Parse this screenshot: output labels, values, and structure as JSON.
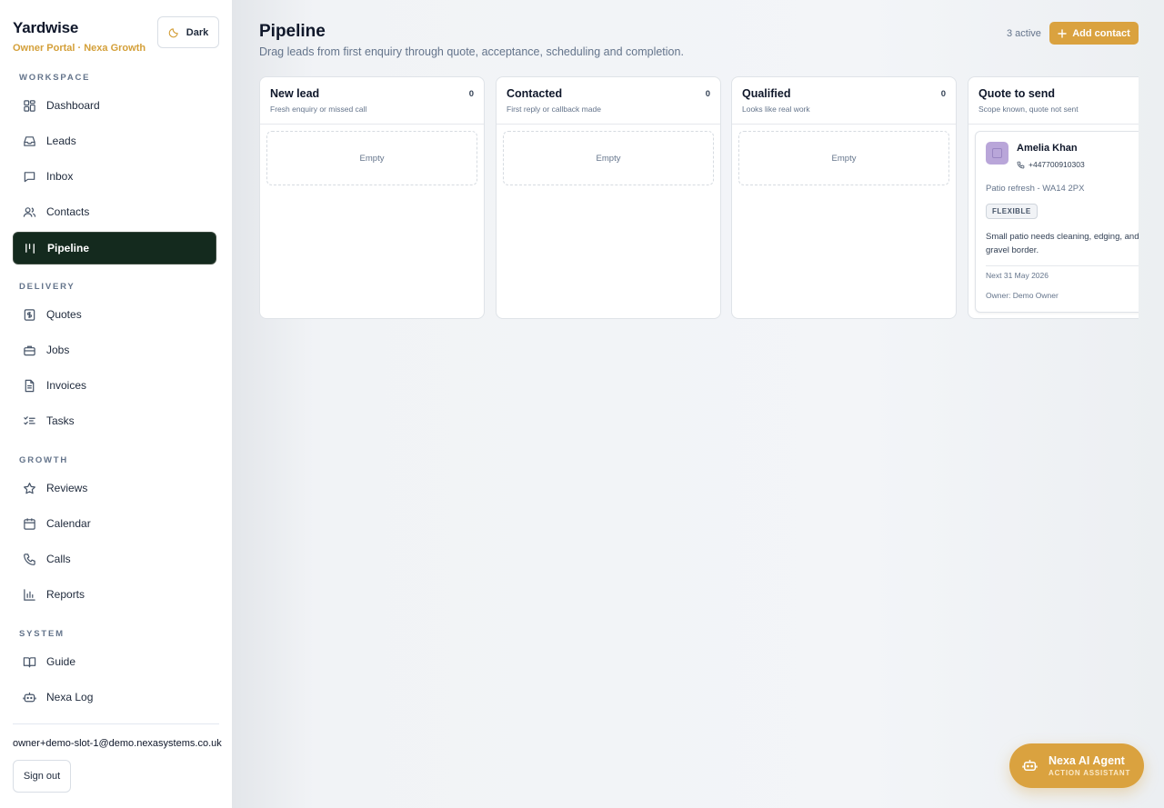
{
  "brand": {
    "name": "Yardwise",
    "subtitle": "Owner Portal · Nexa Growth"
  },
  "theme_toggle": {
    "label": "Dark",
    "icon": "moon-icon"
  },
  "sidebar": {
    "sections": [
      {
        "label": "WORKSPACE",
        "items": [
          {
            "label": "Dashboard",
            "icon": "dashboard-icon"
          },
          {
            "label": "Leads",
            "icon": "inbox-tray-icon"
          },
          {
            "label": "Inbox",
            "icon": "message-icon"
          },
          {
            "label": "Contacts",
            "icon": "users-icon"
          },
          {
            "label": "Pipeline",
            "icon": "kanban-icon",
            "active": true
          }
        ]
      },
      {
        "label": "DELIVERY",
        "items": [
          {
            "label": "Quotes",
            "icon": "dollar-file-icon"
          },
          {
            "label": "Jobs",
            "icon": "briefcase-icon"
          },
          {
            "label": "Invoices",
            "icon": "document-icon"
          },
          {
            "label": "Tasks",
            "icon": "checklist-icon"
          }
        ]
      },
      {
        "label": "GROWTH",
        "items": [
          {
            "label": "Reviews",
            "icon": "star-icon"
          },
          {
            "label": "Calendar",
            "icon": "calendar-icon"
          },
          {
            "label": "Calls",
            "icon": "phone-icon"
          },
          {
            "label": "Reports",
            "icon": "bar-chart-icon"
          }
        ]
      },
      {
        "label": "SYSTEM",
        "items": [
          {
            "label": "Guide",
            "icon": "book-icon"
          },
          {
            "label": "Nexa Log",
            "icon": "bot-icon"
          }
        ]
      }
    ],
    "user_email": "owner+demo-slot-1@demo.nexasystems.co.uk",
    "sign_out": "Sign out"
  },
  "page": {
    "title": "Pipeline",
    "description": "Drag leads from first enquiry through quote, acceptance, scheduling and completion.",
    "active_count": "3 active",
    "add_button": "Add contact"
  },
  "columns": [
    {
      "name": "New lead",
      "description": "Fresh enquiry or missed call",
      "count": "0",
      "empty_label": "Empty"
    },
    {
      "name": "Contacted",
      "description": "First reply or callback made",
      "count": "0",
      "empty_label": "Empty"
    },
    {
      "name": "Qualified",
      "description": "Looks like real work",
      "count": "0",
      "empty_label": "Empty"
    },
    {
      "name": "Quote to send",
      "description": "Scope known, quote not sent",
      "count": ""
    }
  ],
  "lead_card": {
    "name": "Amelia Khan",
    "phone": "+447700910303",
    "title": "Patio refresh - WA14 2PX",
    "badge": "FLEXIBLE",
    "notes": "Small patio needs cleaning, edging, and gravel border.",
    "next": "Next 31 May 2026",
    "owner": "Owner: Demo Owner"
  },
  "agent_button": {
    "title": "Nexa AI Agent",
    "subtitle": "ACTION ASSISTANT"
  },
  "colors": {
    "accent": "#daa23f",
    "active_nav": "#142a1e",
    "brand_sub": "#d4a03a"
  }
}
